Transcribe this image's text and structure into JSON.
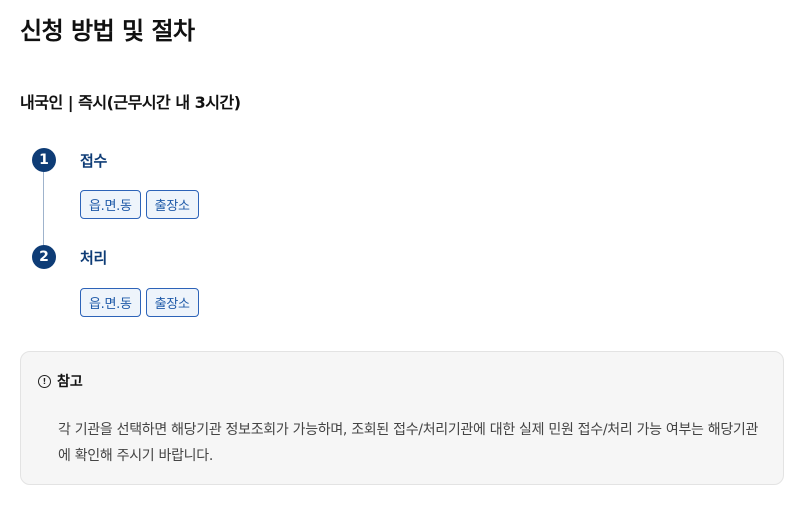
{
  "section": {
    "title": "신청 방법 및 절차",
    "subtitle": "내국인 | 즉시(근무시간 내 3시간)"
  },
  "steps": [
    {
      "number": "1",
      "title": "접수",
      "options": [
        "읍.면.동",
        "출장소"
      ]
    },
    {
      "number": "2",
      "title": "처리",
      "options": [
        "읍.면.동",
        "출장소"
      ]
    }
  ],
  "note": {
    "icon": "info-icon",
    "icon_glyph": "!",
    "title": "참고",
    "text": "각 기관을 선택하면 해당기관 정보조회가 가능하며, 조회된 접수/처리기관에 대한 실제 민원 접수/처리 가능 여부는 해당기관에 확인해 주시기 바랍니다."
  },
  "colors": {
    "accent": "#0e3c76",
    "chip_border": "#2d63b8",
    "chip_bg": "#eef4fb"
  }
}
